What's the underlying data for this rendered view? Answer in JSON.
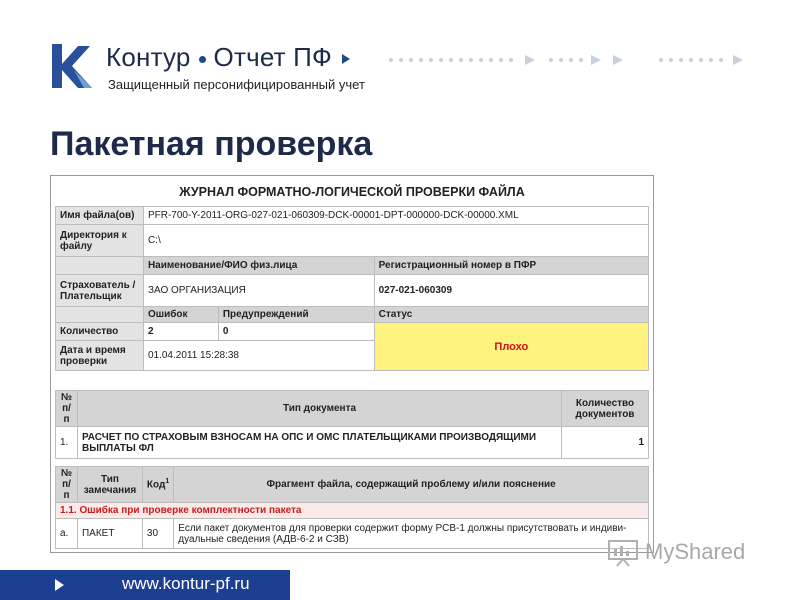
{
  "header": {
    "brand_name_1": "Контур",
    "brand_name_2": "Отчет ПФ",
    "tagline": "Защищенный персонифицированный учет"
  },
  "page_title": "Пакетная проверка",
  "report": {
    "title": "ЖУРНАЛ ФОРМАТНО-ЛОГИЧЕСКОЙ ПРОВЕРКИ ФАЙЛА",
    "file_name_label": "Имя файла(ов)",
    "file_name_value": "PFR-700-Y-2011-ORG-027-021-060309-DCK-00001-DPT-000000-DCK-00000.XML",
    "dir_label": "Директория к файлу",
    "dir_value": "C:\\",
    "col_name_header": "Наименование/ФИО физ.лица",
    "col_regnum_header": "Регистрационный номер в ПФР",
    "insurer_label": "Страхователь / Плательщик",
    "insurer_name": "ЗАО ОРГАНИЗАЦИЯ",
    "insurer_regnum": "027-021-060309",
    "errors_header": "Ошибок",
    "warnings_header": "Предупреждений",
    "status_header": "Статус",
    "count_label": "Количество",
    "errors_count": "2",
    "warnings_count": "0",
    "status_value": "Плохо",
    "datetime_label": "Дата и время проверки",
    "datetime_value": "01.04.2011 15:28:38",
    "doc_table": {
      "h_num": "№ п/п",
      "h_type": "Тип документа",
      "h_count": "Количество документов",
      "rows": [
        {
          "num": "1.",
          "type": "РАСЧЕТ ПО СТРАХОВЫМ ВЗНОСАМ НА ОПС И ОМС ПЛАТЕЛЬЩИКАМИ ПРОИЗВОДЯЩИМИ ВЫПЛАТЫ ФЛ",
          "count": "1"
        }
      ]
    },
    "err_table": {
      "h_num": "№ п/п",
      "h_type": "Тип замечания",
      "h_code": "Код",
      "h_code_sup": "1",
      "h_fragment": "Фрагмент файла, содержащий проблему и/или пояснение",
      "section": "1.1. Ошибка при проверке комплектности пакета",
      "rows": [
        {
          "num": "а.",
          "type": "ПАКЕТ",
          "code": "30",
          "text": "Если пакет документов для проверки содержит форму РСВ-1 должны присутствовать и индиви-дуальные сведения (АДВ-6-2 и СЗВ)"
        }
      ]
    }
  },
  "footer": {
    "url": "www.kontur-pf.ru"
  },
  "watermark": {
    "text": "MyShared"
  },
  "colors": {
    "brand_blue": "#1d3f91",
    "title_navy": "#1d2a4a",
    "status_bad_bg": "#fff380",
    "status_bad_text": "#d0101b"
  }
}
